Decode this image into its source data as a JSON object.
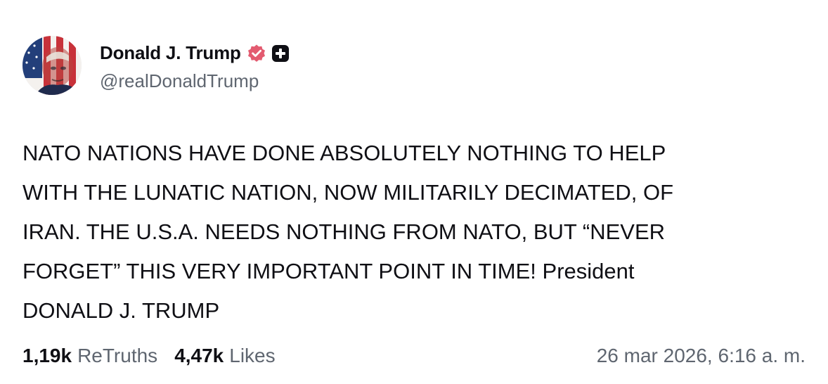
{
  "author": {
    "display_name": "Donald J. Trump",
    "handle": "@realDonaldTrump",
    "avatar_icon": "flag-portrait-avatar",
    "verified_icon": "verified-badge-icon",
    "plus_icon": "plus-badge-icon"
  },
  "post": {
    "text": "NATO NATIONS HAVE DONE ABSOLUTELY NOTHING TO HELP\nWITH THE LUNATIC NATION, NOW MILITARILY DECIMATED, OF\nIRAN. THE U.S.A. NEEDS NOTHING FROM NATO, BUT “NEVER\nFORGET” THIS VERY IMPORTANT POINT IN TIME! President\nDONALD J. TRUMP"
  },
  "stats": {
    "retruths_count": "1,19k",
    "retruths_label": "ReTruths",
    "likes_count": "4,47k",
    "likes_label": "Likes"
  },
  "timestamp": "26 mar 2026, 6:16 a. m.",
  "colors": {
    "text": "#0f0f14",
    "muted": "#5f6670",
    "verified": "#e35b70",
    "background": "#ffffff"
  }
}
